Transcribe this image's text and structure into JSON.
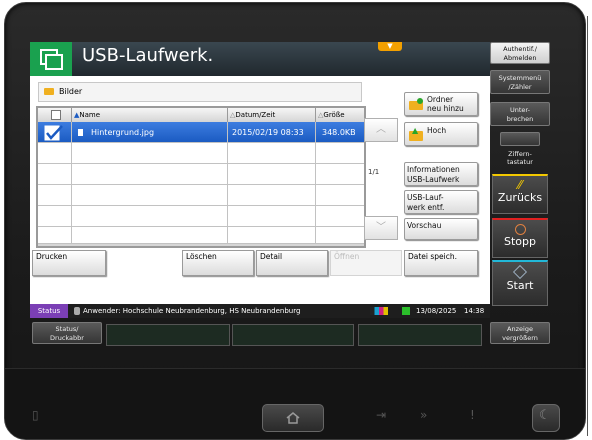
{
  "window": {
    "title": "USB-Laufwerk."
  },
  "folder": {
    "name": "Bilder"
  },
  "table": {
    "headers": {
      "name": "Name",
      "date": "Datum/Zeit",
      "size": "Größe"
    },
    "rows": [
      {
        "name": "Hintergrund.jpg",
        "date": "2015/02/19 08:33",
        "size": "348.0KB",
        "selected": true
      }
    ],
    "page": "1/1"
  },
  "right_buttons": {
    "new_folder": [
      "Ordner",
      "neu hinzu"
    ],
    "up": "Hoch",
    "usb_info": [
      "Informationen",
      "USB-Laufwerk"
    ],
    "usb_remove": [
      "USB-Lauf-",
      "werk entf."
    ],
    "preview": "Vorschau"
  },
  "bottom_buttons": {
    "print": "Drucken",
    "delete": "Löschen",
    "detail": "Detail",
    "open": "Öffnen",
    "save_file": "Datei speich."
  },
  "status": {
    "label": "Status",
    "user": "Anwender: Hochschule Neubrandenburg, HS Neubrandenburg",
    "date": "13/08/2025",
    "time": "14:38"
  },
  "panel": {
    "auth": [
      "Authentif./",
      "Abmelden"
    ],
    "system_menu": [
      "Systemmenü",
      "/Zähler"
    ],
    "interrupt": [
      "Unter-",
      "brechen"
    ],
    "numpad": [
      "Ziffern-",
      "tastatur"
    ],
    "back": "Zurücks",
    "stop": "Stopp",
    "start": "Start",
    "status_job": [
      "Status/",
      "Druckabbr"
    ],
    "display_zoom": [
      "Anzeige",
      "vergrößern"
    ]
  },
  "colors": {
    "title_accent": "#1aa14f",
    "selection": "#1b5bc2",
    "status_label": "#7b3fb5",
    "back_line": "#f3c800",
    "stop_line": "#e02020",
    "start_line": "#22b8d8"
  }
}
